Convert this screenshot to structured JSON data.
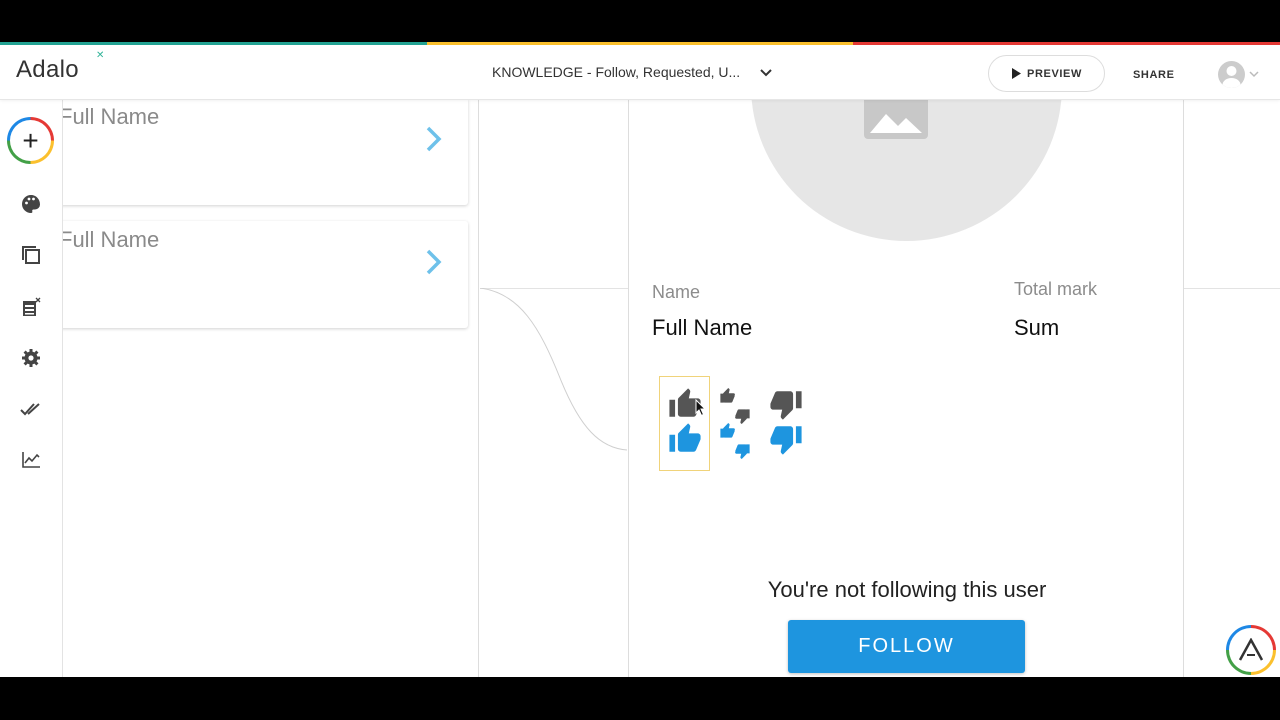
{
  "header": {
    "logo_text": "Adalo",
    "app_title": "KNOWLEDGE - Follow, Requested, U...",
    "preview_label": "PREVIEW",
    "share_label": "SHARE"
  },
  "stripe_colors": [
    "#23a393",
    "#fbc02d",
    "#e53935"
  ],
  "sidebar": {
    "items": [
      {
        "icon": "palette-icon"
      },
      {
        "icon": "screens-icon"
      },
      {
        "icon": "database-icon"
      },
      {
        "icon": "gear-icon"
      },
      {
        "icon": "publish-check-icon"
      },
      {
        "icon": "analytics-icon"
      }
    ]
  },
  "left_screen": {
    "cards": [
      {
        "name": "Full Name"
      },
      {
        "name": "Full Name"
      }
    ]
  },
  "right_screen": {
    "name_label": "Name",
    "name_value": "Full Name",
    "total_label": "Total mark",
    "total_value": "Sum",
    "not_following_text": "You're not following this user",
    "follow_label": "FOLLOW"
  },
  "colors": {
    "accent": "#1e95df",
    "chevron": "#6ec1ea",
    "thumb_dark": "#555555",
    "thumb_blue": "#1e95df"
  }
}
